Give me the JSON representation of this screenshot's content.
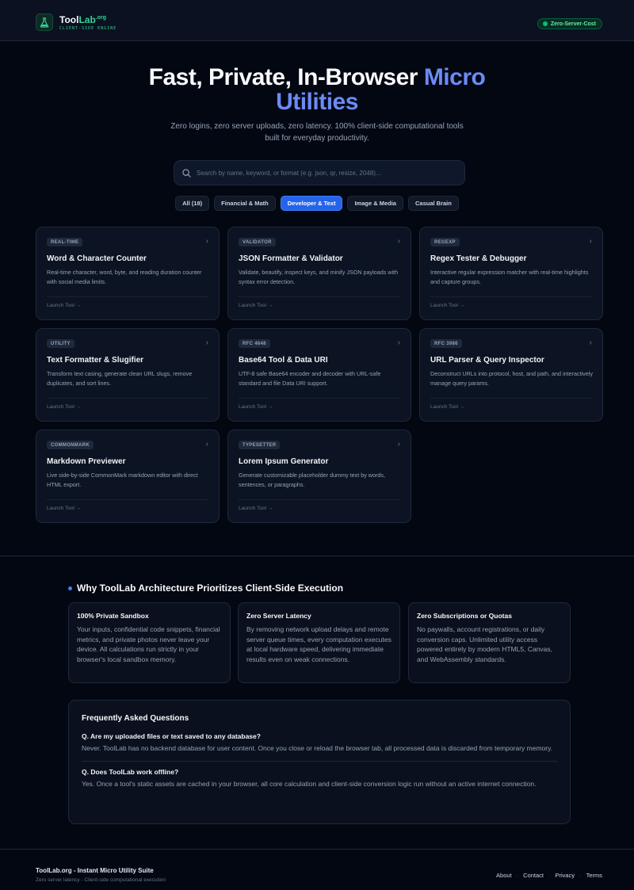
{
  "header": {
    "logo_prefix": "Tool",
    "logo_lab": "Lab",
    "logo_org": ".org",
    "logo_sub": "CLIENT-SIDE ENGINE",
    "badge": "Zero-Server-Cost"
  },
  "hero": {
    "title_main": "Fast, Private, In-Browser",
    "title_accent": "Micro Utilities",
    "subtitle": "Zero logins, zero server uploads, zero latency. 100% client-side computational tools built for everyday productivity.",
    "search_placeholder": "Search by name, keyword, or format (e.g. json, qr, resize, 2048)..."
  },
  "filters": [
    {
      "label": "All (18)",
      "active": false
    },
    {
      "label": "Financial & Math",
      "active": false
    },
    {
      "label": "Developer & Text",
      "active": true
    },
    {
      "label": "Image & Media",
      "active": false
    },
    {
      "label": "Casual Brain",
      "active": false
    }
  ],
  "tools": [
    {
      "tag": "REAL-TIME",
      "title": "Word & Character Counter",
      "desc": "Real-time character, word, byte, and reading duration counter with social media limits.",
      "cta": "Launch Tool →"
    },
    {
      "tag": "VALIDATOR",
      "title": "JSON Formatter & Validator",
      "desc": "Validate, beautify, inspect keys, and minify JSON payloads with syntax error detection.",
      "cta": "Launch Tool →"
    },
    {
      "tag": "REGEXP",
      "title": "Regex Tester & Debugger",
      "desc": "Interactive regular expression matcher with real-time highlights and capture groups.",
      "cta": "Launch Tool →"
    },
    {
      "tag": "UTILITY",
      "title": "Text Formatter & Slugifier",
      "desc": "Transform text casing, generate clean URL slugs, remove duplicates, and sort lines.",
      "cta": "Launch Tool →"
    },
    {
      "tag": "RFC 4648",
      "title": "Base64 Tool & Data URI",
      "desc": "UTF-8 safe Base64 encoder and decoder with URL-safe standard and file Data URI support.",
      "cta": "Launch Tool →"
    },
    {
      "tag": "RFC 3986",
      "title": "URL Parser & Query Inspector",
      "desc": "Deconstruct URLs into protocol, host, and path, and interactively manage query params.",
      "cta": "Launch Tool →"
    },
    {
      "tag": "COMMONMARK",
      "title": "Markdown Previewer",
      "desc": "Live side-by-side CommonMark markdown editor with direct HTML export.",
      "cta": "Launch Tool →"
    },
    {
      "tag": "TYPESETTER",
      "title": "Lorem Ipsum Generator",
      "desc": "Generate customizable placeholder dummy text by words, sentences, or paragraphs.",
      "cta": "Launch Tool →"
    }
  ],
  "why": {
    "title": "Why ToolLab Architecture Prioritizes Client-Side Execution",
    "cards": [
      {
        "title": "100% Private Sandbox",
        "text": "Your inputs, confidential code snippets, financial metrics, and private photos never leave your device. All calculations run strictly in your browser's local sandbox memory."
      },
      {
        "title": "Zero Server Latency",
        "text": "By removing network upload delays and remote server queue times, every computation executes at local hardware speed, delivering immediate results even on weak connections."
      },
      {
        "title": "Zero Subscriptions or Quotas",
        "text": "No paywalls, account registrations, or daily conversion caps. Unlimited utility access powered entirely by modern HTML5, Canvas, and WebAssembly standards."
      }
    ]
  },
  "faq": {
    "title": "Frequently Asked Questions",
    "items": [
      {
        "q": "Q. Are my uploaded files or text saved to any database?",
        "a": "Never. ToolLab has no backend database for user content. Once you close or reload the browser tab, all processed data is discarded from temporary memory."
      },
      {
        "q": "Q. Does ToolLab work offline?",
        "a": "Yes. Once a tool's static assets are cached in your browser, all core calculation and client-side conversion logic run without an active internet connection."
      }
    ]
  },
  "footer": {
    "title": "ToolLab.org - Instant Micro Utility Suite",
    "subtitle": "Zero server latency - Client-side computational execution",
    "links": [
      "About",
      "Contact",
      "Privacy",
      "Terms"
    ],
    "separator": "·"
  },
  "colors": {
    "background": "#030712",
    "accent": "#6b8bf5",
    "active_chip": "#2563eb",
    "brand_green": "#34d399"
  }
}
